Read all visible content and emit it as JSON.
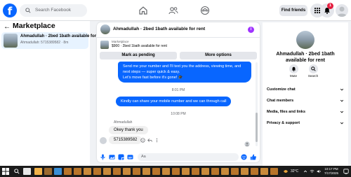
{
  "topnav": {
    "logo": "f",
    "search_placeholder": "Search Facebook",
    "find_friends": "Find friends",
    "notif_count": "1",
    "icons": [
      "home-icon",
      "friends-icon",
      "groups-icon",
      "menu-grid-icon",
      "messenger-icon",
      "bell-icon"
    ]
  },
  "sidebar": {
    "title": "Marketplace",
    "back": "←",
    "conversation": {
      "name": "Ahmadullah · 2bed 1bath available for rent",
      "subtitle": "Ahmadullah: 5715389582 · 8m"
    }
  },
  "chat": {
    "header_title": "Ahmadullah · 2bed 1bath available for rent",
    "info_icon": "i",
    "listing": {
      "label": "Marketplace",
      "line": "$900 · 2bed 1bath available for rent"
    },
    "mark_pending": "Mark as pending",
    "more_options": "More options",
    "messages": {
      "out1_l1": "Send me your number and I'll text you the address, viewing time, and",
      "out1_l2": "next steps — super quick & easy.",
      "out1_l3": "Let's move fast before it's gone! 🎓",
      "time1": "8:01 PM",
      "out2": "Kindly can share your mobile number and we can through call",
      "time2": "10:08 PM",
      "sender": "Ahmadullah",
      "in1": "Okey thank you",
      "in2": "5715389582"
    },
    "composer_placeholder": "Aa"
  },
  "right_panel": {
    "name_l1": "Ahmadullah · 2bed 1bath",
    "name_l2": "available for rent",
    "mute": "Mute",
    "search": "Search",
    "sections": [
      "Customize chat",
      "Chat members",
      "Media, files and links",
      "Privacy & support"
    ]
  },
  "taskbar": {
    "temperature": "32°C",
    "time": "10:17 PM",
    "date": "7/17/2025"
  },
  "colors": {
    "accent": "#0866ff",
    "badge": "#e41e3f",
    "info": "#a033ff"
  }
}
